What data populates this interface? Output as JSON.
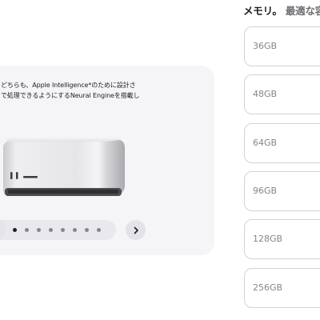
{
  "memory": {
    "heading": "メモリ。",
    "subheading": "最適な容",
    "options": [
      "36GB",
      "48GB",
      "64GB",
      "96GB",
      "128GB",
      "256GB"
    ]
  },
  "carousel": {
    "text_line1": "どちらも、Apple Intelligence*のために設計さ",
    "text_line2": "で処理できるようにするNeural Engineを搭載し",
    "page_count": 8,
    "active_page": 1
  },
  "colors": {
    "card_bg": "#f5f5f7",
    "paging_bg": "#e8e8ed",
    "border": "#d2d2d7",
    "muted_text": "#86868b"
  },
  "icons": {
    "next": "chevron-right-icon",
    "product": "mac-studio-image"
  }
}
